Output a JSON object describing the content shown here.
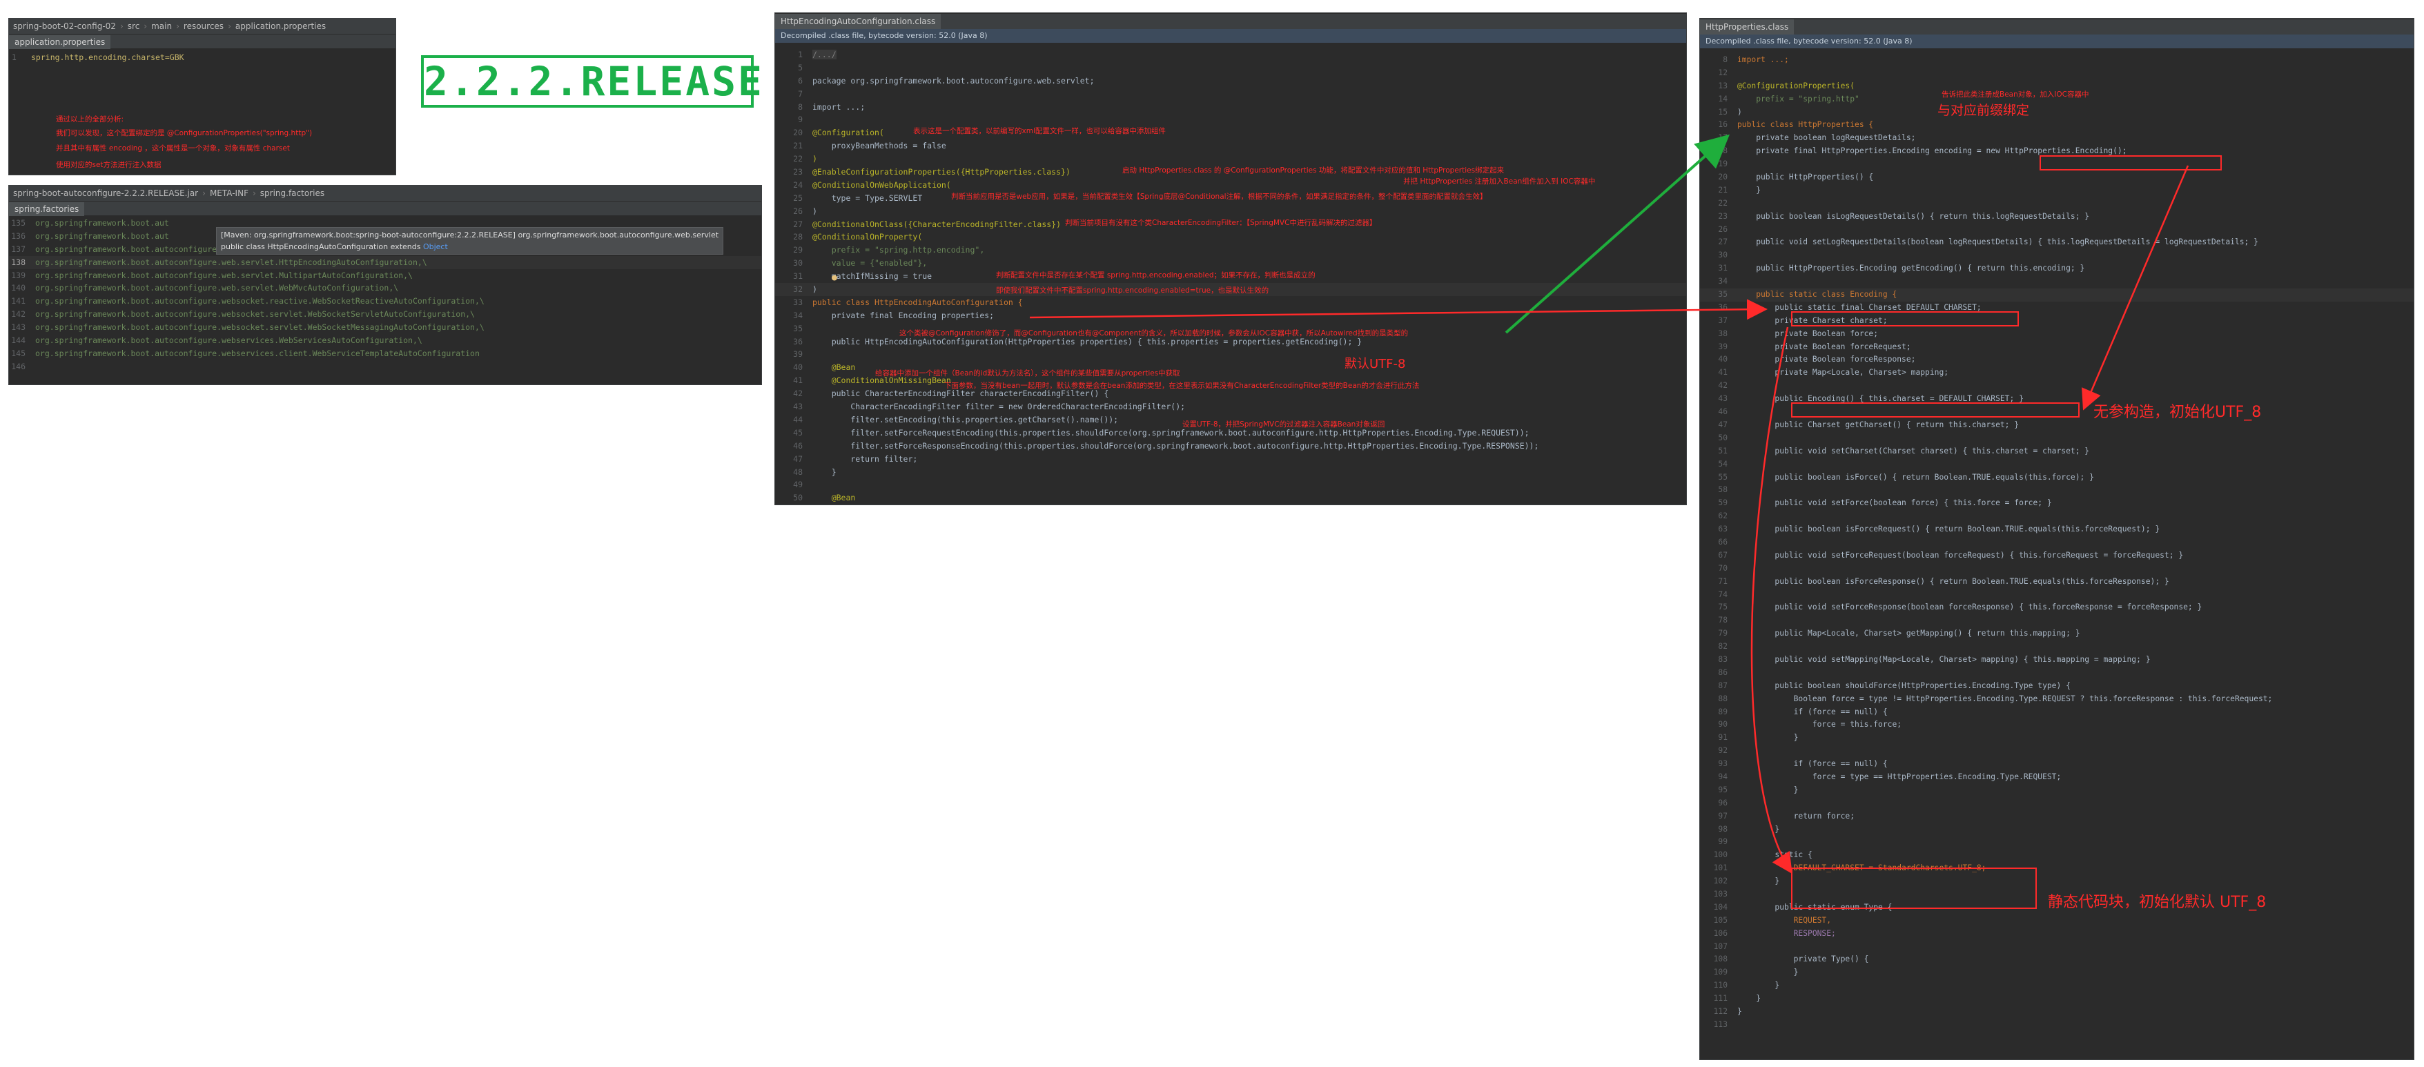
{
  "release_badge": "2.2.2.RELEASE",
  "panel1": {
    "breadcrumb": [
      "spring-boot-02-config-02",
      "src",
      "main",
      "resources",
      "application.properties"
    ],
    "tab": "application.properties",
    "code_line_no": "1",
    "code": "spring.http.encoding.charset=GBK",
    "notes": [
      "通过以上的全部分析:",
      "我们可以发现，这个配置绑定的是 @ConfigurationProperties(\"spring.http\")",
      "并且其中有属性 encoding ，这个属性是一个对象，对象有属性 charset",
      "使用对应的set方法进行注入数据"
    ]
  },
  "panel2": {
    "breadcrumb": [
      "spring-boot-autoconfigure-2.2.2.RELEASE.jar",
      "META-INF",
      "spring.factories"
    ],
    "tab": "spring.factories",
    "tooltip_line1": "[Maven: org.springframework.boot:spring-boot-autoconfigure:2.2.2.RELEASE] org.springframework.boot.autoconfigure.web.servlet",
    "tooltip_line2_prefix": "public class HttpEncodingAutoConfiguration extends ",
    "tooltip_line2_link": "Object",
    "lines": [
      {
        "n": "135",
        "t": "org.springframework.boot.aut"
      },
      {
        "n": "136",
        "t": "org.springframework.boot.aut"
      },
      {
        "n": "137",
        "t": "org.springframework.boot.autoconfigure.web.servlet.DispatcherServletAutoConfiguration,\\"
      },
      {
        "n": "138",
        "t": "org.springframework.boot.autoconfigure.web.servlet.HttpEncodingAutoConfiguration,\\"
      },
      {
        "n": "139",
        "t": "org.springframework.boot.autoconfigure.web.servlet.MultipartAutoConfiguration,\\"
      },
      {
        "n": "140",
        "t": "org.springframework.boot.autoconfigure.web.servlet.WebMvcAutoConfiguration,\\"
      },
      {
        "n": "141",
        "t": "org.springframework.boot.autoconfigure.websocket.reactive.WebSocketReactiveAutoConfiguration,\\"
      },
      {
        "n": "142",
        "t": "org.springframework.boot.autoconfigure.websocket.servlet.WebSocketServletAutoConfiguration,\\"
      },
      {
        "n": "143",
        "t": "org.springframework.boot.autoconfigure.websocket.servlet.WebSocketMessagingAutoConfiguration,\\"
      },
      {
        "n": "144",
        "t": "org.springframework.boot.autoconfigure.webservices.WebServicesAutoConfiguration,\\"
      },
      {
        "n": "145",
        "t": "org.springframework.boot.autoconfigure.webservices.client.WebServiceTemplateAutoConfiguration"
      },
      {
        "n": "146",
        "t": ""
      }
    ]
  },
  "panel3": {
    "tab": "HttpEncodingAutoConfiguration.class",
    "info": "Decompiled .class file, bytecode version: 52.0 (Java 8)",
    "lines": [
      {
        "n": "1",
        "t": "/.../"
      },
      {
        "n": "5",
        "t": ""
      },
      {
        "n": "6",
        "t": "package org.springframework.boot.autoconfigure.web.servlet;"
      },
      {
        "n": "7",
        "t": ""
      },
      {
        "n": "8",
        "t": "import ...;"
      },
      {
        "n": "9",
        "t": ""
      },
      {
        "n": "20",
        "t": "@Configuration("
      },
      {
        "n": "21",
        "t": "    proxyBeanMethods = false"
      },
      {
        "n": "22",
        "t": ")"
      },
      {
        "n": "23",
        "t": "@EnableConfigurationProperties({HttpProperties.class})"
      },
      {
        "n": "24",
        "t": "@ConditionalOnWebApplication("
      },
      {
        "n": "25",
        "t": "    type = Type.SERVLET"
      },
      {
        "n": "26",
        "t": ")"
      },
      {
        "n": "27",
        "t": "@ConditionalOnClass({CharacterEncodingFilter.class})"
      },
      {
        "n": "28",
        "t": "@ConditionalOnProperty("
      },
      {
        "n": "29",
        "t": "    prefix = \"spring.http.encoding\","
      },
      {
        "n": "30",
        "t": "    value = {\"enabled\"},"
      },
      {
        "n": "31",
        "t": "    matchIfMissing = true"
      },
      {
        "n": "32",
        "t": ")"
      },
      {
        "n": "33",
        "t": "public class HttpEncodingAutoConfiguration {"
      },
      {
        "n": "34",
        "t": "    private final Encoding properties;"
      },
      {
        "n": "35",
        "t": ""
      },
      {
        "n": "36",
        "t": "    public HttpEncodingAutoConfiguration(HttpProperties properties) { this.properties = properties.getEncoding(); }"
      },
      {
        "n": "39",
        "t": ""
      },
      {
        "n": "40",
        "t": "    @Bean"
      },
      {
        "n": "41",
        "t": "    @ConditionalOnMissingBean"
      },
      {
        "n": "42",
        "t": "    public CharacterEncodingFilter characterEncodingFilter() {"
      },
      {
        "n": "43",
        "t": "        CharacterEncodingFilter filter = new OrderedCharacterEncodingFilter();"
      },
      {
        "n": "44",
        "t": "        filter.setEncoding(this.properties.getCharset().name());"
      },
      {
        "n": "45",
        "t": "        filter.setForceRequestEncoding(this.properties.shouldForce(org.springframework.boot.autoconfigure.http.HttpProperties.Encoding.Type.REQUEST));"
      },
      {
        "n": "46",
        "t": "        filter.setForceResponseEncoding(this.properties.shouldForce(org.springframework.boot.autoconfigure.http.HttpProperties.Encoding.Type.RESPONSE));"
      },
      {
        "n": "47",
        "t": "        return filter;"
      },
      {
        "n": "48",
        "t": "    }"
      },
      {
        "n": "49",
        "t": ""
      },
      {
        "n": "50",
        "t": "    @Bean"
      }
    ],
    "notes": {
      "configuration": "表示这是一个配置类，以前编写的xml配置文件一样，也可以给容器中添加组件",
      "enable_props": "启动 HttpProperties.class 的 @ConfigurationProperties 功能，将配置文件中对应的值和 HttpProperties绑定起来",
      "enable_props2": "并把 HttpProperties 注册加入Bean组件加入到 IOC容器中",
      "web_app": "判断当前应用是否是web应用，如果是，当前配置类生效【Spring底层@Conditional注解，根据不同的条件，如果满足指定的条件，整个配置类里面的配置就会生效】",
      "on_class": "判断当前项目有没有这个类CharacterEncodingFilter：【SpringMVC中进行乱码解决的过滤器】",
      "on_property": "判断配置文件中是否存在某个配置 spring.http.encoding.enabled；如果不存在，判断也是成立的",
      "on_property2": "即使我们配置文件中不配置spring.http.encoding.enabled=true，也是默认生效的",
      "constructor": "这个类被@Configuration修饰了，而@Configuration也有@Component的含义，所以加载的时候，参数会从IOC容器中获，所以Autowired找到的是类型的",
      "default_utf8": "默认UTF-8",
      "bean": "给容器中添加一个组件（Bean的id默认为方法名），这个组件的某些值需要从properties中获取",
      "missing_bean": "下面参数，当没有bean一起用时，默认参数是会在bean添加的类型，在这里表示如果没有CharacterEncodingFilter类型的Bean的才会进行此方法",
      "set_encoding": "设置UTF-8，并把SpringMVC的过滤器注入容器Bean对象返回"
    }
  },
  "panel4": {
    "tab": "HttpProperties.class",
    "info": "Decompiled .class file, bytecode version: 52.0 (Java 8)",
    "lines": [
      {
        "n": "8",
        "t": "import ...;"
      },
      {
        "n": "12",
        "t": ""
      },
      {
        "n": "13",
        "t": "@ConfigurationProperties("
      },
      {
        "n": "14",
        "t": "    prefix = \"spring.http\""
      },
      {
        "n": "15",
        "t": ")"
      },
      {
        "n": "16",
        "t": "public class HttpProperties {"
      },
      {
        "n": "17",
        "t": "    private boolean logRequestDetails;"
      },
      {
        "n": "18",
        "t": "    private final HttpProperties.Encoding encoding = new HttpProperties.Encoding();"
      },
      {
        "n": "19",
        "t": ""
      },
      {
        "n": "20",
        "t": "    public HttpProperties() {"
      },
      {
        "n": "21",
        "t": "    }"
      },
      {
        "n": "22",
        "t": ""
      },
      {
        "n": "23",
        "t": "    public boolean isLogRequestDetails() { return this.logRequestDetails; }"
      },
      {
        "n": "26",
        "t": ""
      },
      {
        "n": "27",
        "t": "    public void setLogRequestDetails(boolean logRequestDetails) { this.logRequestDetails = logRequestDetails; }"
      },
      {
        "n": "30",
        "t": ""
      },
      {
        "n": "31",
        "t": "    public HttpProperties.Encoding getEncoding() { return this.encoding; }"
      },
      {
        "n": "34",
        "t": ""
      },
      {
        "n": "35",
        "t": "    public static class Encoding {"
      },
      {
        "n": "36",
        "t": "        public static final Charset DEFAULT_CHARSET;"
      },
      {
        "n": "37",
        "t": "        private Charset charset;"
      },
      {
        "n": "38",
        "t": "        private Boolean force;"
      },
      {
        "n": "39",
        "t": "        private Boolean forceRequest;"
      },
      {
        "n": "40",
        "t": "        private Boolean forceResponse;"
      },
      {
        "n": "41",
        "t": "        private Map<Locale, Charset> mapping;"
      },
      {
        "n": "42",
        "t": ""
      },
      {
        "n": "43",
        "t": "        public Encoding() { this.charset = DEFAULT_CHARSET; }"
      },
      {
        "n": "46",
        "t": ""
      },
      {
        "n": "47",
        "t": "        public Charset getCharset() { return this.charset; }"
      },
      {
        "n": "50",
        "t": ""
      },
      {
        "n": "51",
        "t": "        public void setCharset(Charset charset) { this.charset = charset; }"
      },
      {
        "n": "54",
        "t": ""
      },
      {
        "n": "55",
        "t": "        public boolean isForce() { return Boolean.TRUE.equals(this.force); }"
      },
      {
        "n": "58",
        "t": ""
      },
      {
        "n": "59",
        "t": "        public void setForce(boolean force) { this.force = force; }"
      },
      {
        "n": "62",
        "t": ""
      },
      {
        "n": "63",
        "t": "        public boolean isForceRequest() { return Boolean.TRUE.equals(this.forceRequest); }"
      },
      {
        "n": "66",
        "t": ""
      },
      {
        "n": "67",
        "t": "        public void setForceRequest(boolean forceRequest) { this.forceRequest = forceRequest; }"
      },
      {
        "n": "70",
        "t": ""
      },
      {
        "n": "71",
        "t": "        public boolean isForceResponse() { return Boolean.TRUE.equals(this.forceResponse); }"
      },
      {
        "n": "74",
        "t": ""
      },
      {
        "n": "75",
        "t": "        public void setForceResponse(boolean forceResponse) { this.forceResponse = forceResponse; }"
      },
      {
        "n": "78",
        "t": ""
      },
      {
        "n": "79",
        "t": "        public Map<Locale, Charset> getMapping() { return this.mapping; }"
      },
      {
        "n": "82",
        "t": ""
      },
      {
        "n": "83",
        "t": "        public void setMapping(Map<Locale, Charset> mapping) { this.mapping = mapping; }"
      },
      {
        "n": "86",
        "t": ""
      },
      {
        "n": "87",
        "t": "        public boolean shouldForce(HttpProperties.Encoding.Type type) {"
      },
      {
        "n": "88",
        "t": "            Boolean force = type != HttpProperties.Encoding.Type.REQUEST ? this.forceResponse : this.forceRequest;"
      },
      {
        "n": "89",
        "t": "            if (force == null) {"
      },
      {
        "n": "90",
        "t": "                force = this.force;"
      },
      {
        "n": "91",
        "t": "            }"
      },
      {
        "n": "92",
        "t": ""
      },
      {
        "n": "93",
        "t": "            if (force == null) {"
      },
      {
        "n": "94",
        "t": "                force = type == HttpProperties.Encoding.Type.REQUEST;"
      },
      {
        "n": "95",
        "t": "            }"
      },
      {
        "n": "96",
        "t": ""
      },
      {
        "n": "97",
        "t": "            return force;"
      },
      {
        "n": "98",
        "t": "        }"
      },
      {
        "n": "99",
        "t": ""
      },
      {
        "n": "100",
        "t": "        static {"
      },
      {
        "n": "101",
        "t": "            DEFAULT_CHARSET = StandardCharsets.UTF_8;"
      },
      {
        "n": "102",
        "t": "        }"
      },
      {
        "n": "103",
        "t": ""
      },
      {
        "n": "104",
        "t": "        public static enum Type {"
      },
      {
        "n": "105",
        "t": "            REQUEST,"
      },
      {
        "n": "106",
        "t": "            RESPONSE;"
      },
      {
        "n": "107",
        "t": ""
      },
      {
        "n": "108",
        "t": "            private Type() {"
      },
      {
        "n": "109",
        "t": "            }"
      },
      {
        "n": "110",
        "t": "        }"
      },
      {
        "n": "111",
        "t": "    }"
      },
      {
        "n": "112",
        "t": "}"
      },
      {
        "n": "113",
        "t": ""
      }
    ],
    "notes": {
      "prefix_small": "告诉把此类注册成Bean对象，加入IOC容器中",
      "prefix_big": "与对应前缀绑定",
      "no_arg": "无参构造，初始化UTF_8",
      "static_block": "静态代码块，初始化默认 UTF_8"
    }
  },
  "colors": {
    "editor_bg": "#2b2b2b",
    "annotation_red": "#ff2a2a",
    "badge_green": "#1bb04a",
    "arrow_green": "#1fae3c"
  }
}
